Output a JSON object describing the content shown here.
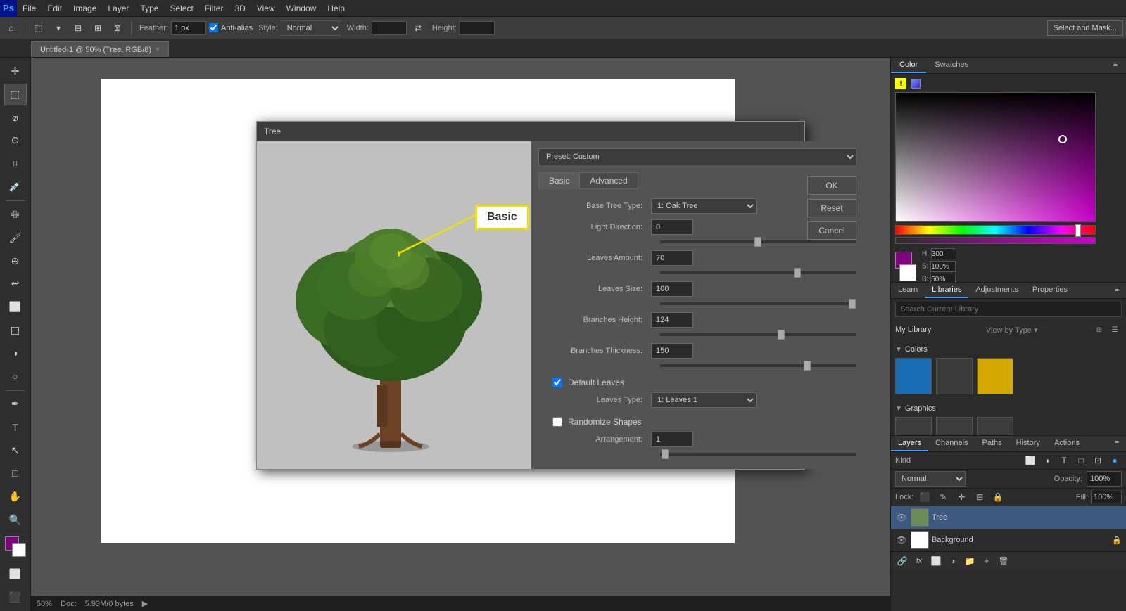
{
  "app": {
    "logo": "Ps",
    "title": "Adobe Photoshop"
  },
  "menu": {
    "items": [
      "File",
      "Edit",
      "Image",
      "Layer",
      "Type",
      "Select",
      "Filter",
      "3D",
      "View",
      "Window",
      "Help"
    ]
  },
  "toolbar": {
    "feather_label": "Feather:",
    "feather_value": "1 px",
    "antialias_label": "Anti-alias",
    "style_label": "Style:",
    "style_value": "Normal",
    "width_label": "Width:",
    "height_label": "Height:",
    "select_mask_btn": "Select and Mask..."
  },
  "tab": {
    "name": "Untitled-1 @ 50% (Tree, RGB/8)",
    "close": "×"
  },
  "tree_dialog": {
    "title": "Tree",
    "preset_label": "Preset: Custom",
    "tabs": [
      "Basic",
      "Advanced"
    ],
    "active_tab": "Basic",
    "annotation": "Basic",
    "base_tree_type_label": "Base Tree Type:",
    "base_tree_type_value": "1: Oak Tree",
    "light_direction_label": "Light Direction:",
    "light_direction_value": "0",
    "leaves_amount_label": "Leaves Amount:",
    "leaves_amount_value": "70",
    "leaves_size_label": "Leaves Size:",
    "leaves_size_value": "100",
    "branches_height_label": "Branches Height:",
    "branches_height_value": "124",
    "branches_thickness_label": "Branches Thickness:",
    "branches_thickness_value": "150",
    "default_leaves_label": "Default Leaves",
    "default_leaves_checked": true,
    "leaves_type_label": "Leaves Type:",
    "leaves_type_value": "1: Leaves 1",
    "randomize_shapes_label": "Randomize Shapes",
    "randomize_shapes_checked": false,
    "arrangement_label": "Arrangement:",
    "arrangement_value": "1",
    "ok_btn": "OK",
    "reset_btn": "Reset",
    "cancel_btn": "Cancel",
    "slider_positions": {
      "light": 0.5,
      "leaves_amount": 0.7,
      "leaves_size": 1.0,
      "branches_height": 0.62,
      "branches_thickness": 0.75,
      "arrangement": 0.05
    }
  },
  "right_panel": {
    "top_tabs": [
      "Color",
      "Swatches"
    ],
    "active_top_tab": "Color"
  },
  "libraries": {
    "tabs": [
      "Learn",
      "Libraries",
      "Adjustments",
      "Properties"
    ],
    "active_tab": "Libraries",
    "search_placeholder": "Search Current Library",
    "my_library": "My Library",
    "view_by": "View by Type",
    "colors_section": "Colors",
    "graphics_section": "Graphics",
    "colors": [
      {
        "hex": "#1a6db3"
      },
      {
        "hex": "#3a3a3a"
      },
      {
        "hex": "#d4a800"
      }
    ]
  },
  "layers": {
    "tabs": [
      "Layers",
      "Channels",
      "Paths",
      "History",
      "Actions"
    ],
    "active_tab": "Layers",
    "filter_kind": "Kind",
    "blend_mode": "Normal",
    "opacity_label": "Opacity:",
    "opacity_value": "100%",
    "lock_label": "Lock:",
    "fill_label": "Fill:",
    "fill_value": "100%",
    "items": [
      {
        "name": "Tree",
        "visible": true,
        "selected": true,
        "thumb_type": "tree",
        "locked": false
      },
      {
        "name": "Background",
        "visible": true,
        "selected": false,
        "thumb_type": "white",
        "locked": true
      }
    ]
  },
  "status": {
    "zoom": "50%",
    "doc_label": "Doc:",
    "doc_value": "5.93M/0 bytes"
  }
}
